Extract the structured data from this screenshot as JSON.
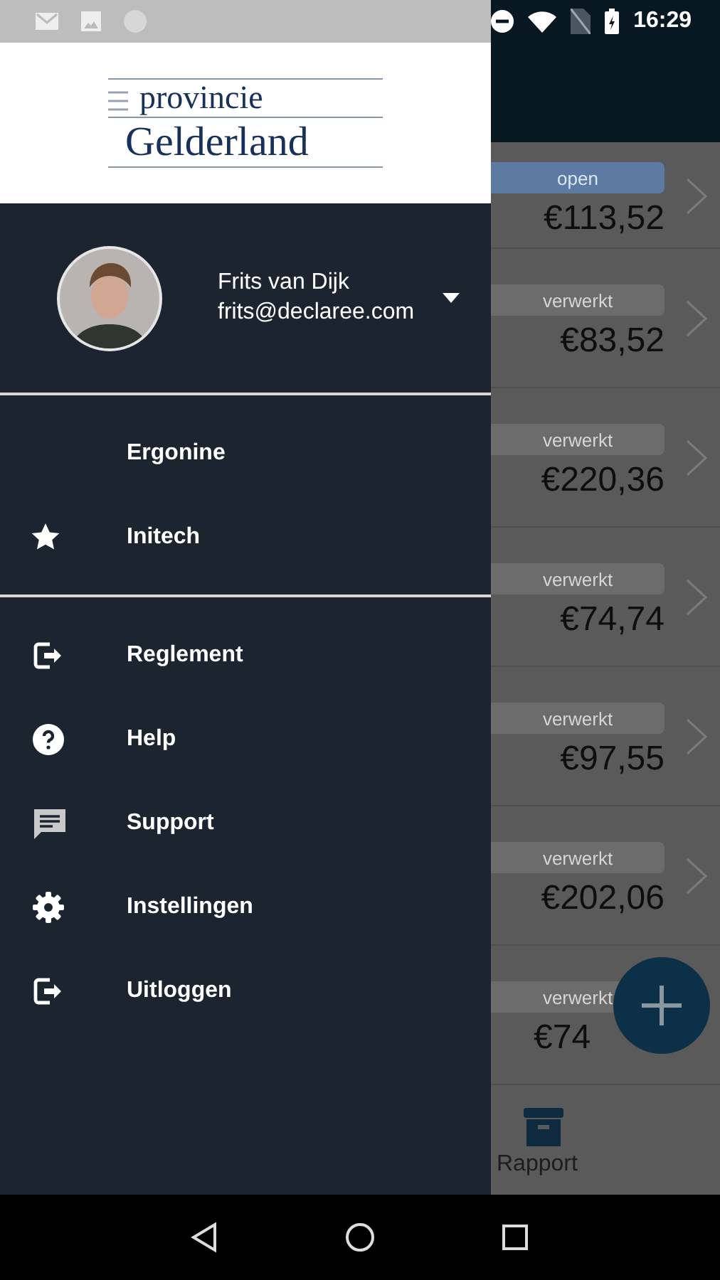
{
  "status_bar": {
    "time": "16:29"
  },
  "drawer": {
    "logo": {
      "line_1": "provincie",
      "line_2": "Gelderland"
    },
    "account": {
      "name": "Frits van Dijk",
      "email": "frits@declaree.com"
    },
    "companies": [
      {
        "label": "Ergonine",
        "selected": false
      },
      {
        "label": "Initech",
        "selected": true
      }
    ],
    "menu": [
      {
        "label": "Reglement",
        "kind": "exit"
      },
      {
        "label": "Help",
        "kind": "help"
      },
      {
        "label": "Support",
        "kind": "chat"
      },
      {
        "label": "Instellingen",
        "kind": "settings"
      },
      {
        "label": "Uitloggen",
        "kind": "exit"
      }
    ]
  },
  "list": {
    "rows": [
      {
        "status": "open",
        "kind": "open",
        "amount": "€113,52"
      },
      {
        "status": "verwerkt",
        "kind": "done",
        "amount": "€83,52"
      },
      {
        "status": "verwerkt",
        "kind": "done",
        "amount": "€220,36"
      },
      {
        "status": "verwerkt",
        "kind": "done",
        "amount": "€74,74"
      },
      {
        "status": "verwerkt",
        "kind": "done",
        "amount": "€97,55"
      },
      {
        "status": "verwerkt",
        "kind": "done",
        "amount": "€202,06"
      },
      {
        "status": "verwerkt",
        "kind": "done",
        "amount": "€74"
      }
    ]
  },
  "bottom_nav": {
    "label": "Rapport"
  }
}
